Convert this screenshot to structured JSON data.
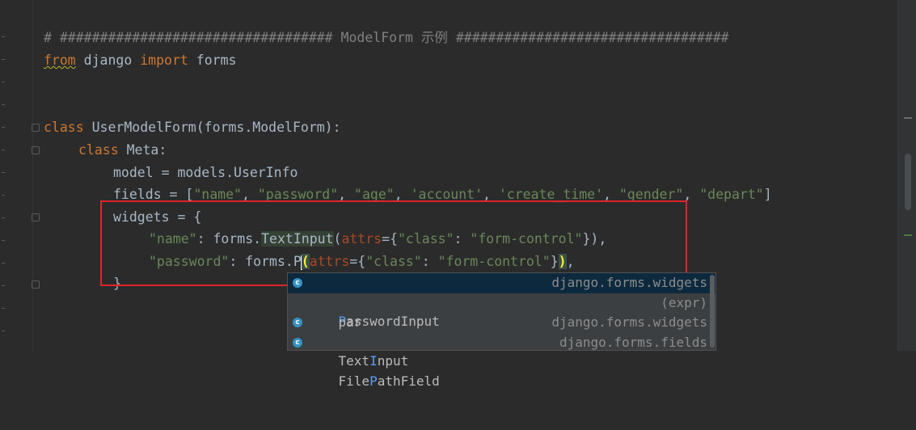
{
  "code": {
    "comment_line": "# ################################## ModelForm 示例 ##################################",
    "import_line": {
      "from": "from",
      "mod": " django ",
      "import": "import",
      "rest": " forms"
    },
    "class_line": {
      "kw": "class",
      "rest": " UserModelForm(forms.ModelForm):"
    },
    "meta_line": {
      "kw": "class",
      "rest": " Meta:"
    },
    "model_line": "model = models.UserInfo",
    "fields_line": {
      "prefix": "fields = [",
      "items": [
        "\"name\"",
        "\"password\"",
        "\"age\"",
        "'account'",
        "'create_time'",
        "\"gender\"",
        "\"depart\""
      ],
      "sep": ", ",
      "suffix": "]"
    },
    "widgets_line": "widgets = {",
    "name_widget": {
      "key": "\"name\"",
      "colon": ": forms.",
      "cls": "TextInput",
      "open": "(",
      "attrs": "attrs",
      "eq": "={",
      "k": "\"class\"",
      "c": ": ",
      "v": "\"form-control\"",
      "close": "}),"
    },
    "password_widget": {
      "key": "\"password\"",
      "colon": ": forms.P",
      "open": "(",
      "attrs": "attrs",
      "eq": "={",
      "k": "\"class\"",
      "c": ": ",
      "v": "\"form-control\"",
      "close": "}",
      "paren": ")",
      "end": ","
    },
    "close_brace": "}"
  },
  "autocomplete": {
    "items": [
      {
        "icon": "class-icon",
        "pre": "",
        "match": "P",
        "post": "asswordInput",
        "where": "django.forms.widgets",
        "selected": true
      },
      {
        "icon": "",
        "pre": "",
        "match": "p",
        "post": "ar",
        "where": "(expr)",
        "selected": false
      },
      {
        "icon": "class-icon",
        "pre": "Text",
        "match": "I",
        "post": "nput",
        "where": "django.forms.widgets",
        "selected": false
      },
      {
        "icon": "class-icon",
        "pre": "File",
        "match": "P",
        "post": "athField",
        "where": "django.forms.fields",
        "selected": false
      }
    ]
  },
  "colors": {
    "background": "#2b2b2b",
    "keyword": "#cc7832",
    "string": "#6a8759",
    "param": "#aa4926",
    "annotation_box": "#e0242b"
  }
}
